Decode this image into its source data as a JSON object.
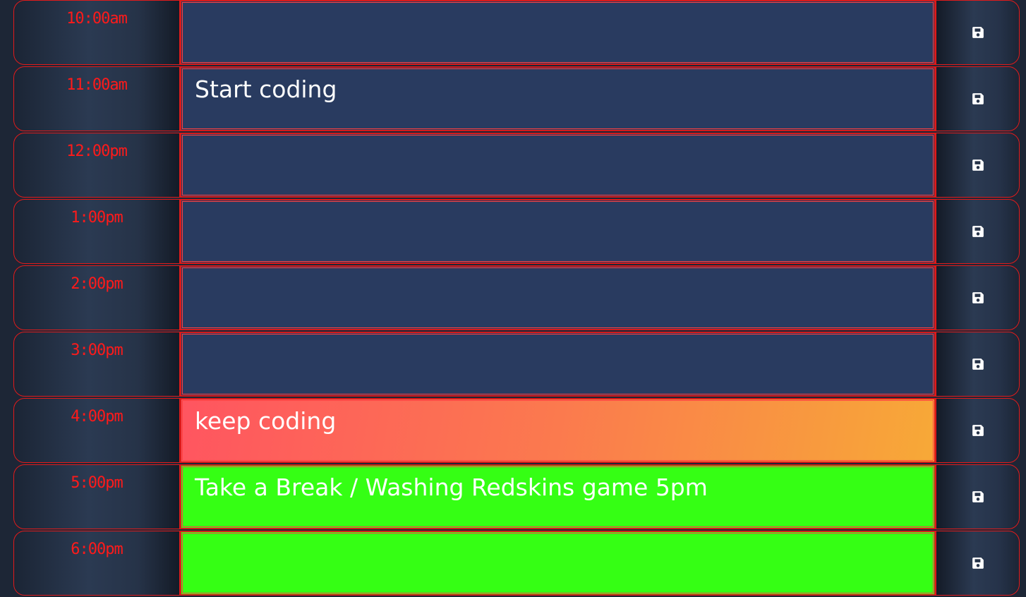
{
  "colors": {
    "past": "#293b60",
    "present_start": "#ff5560",
    "present_end": "#f7a937",
    "future": "#35ff14",
    "hour_text": "#ff1a1a",
    "border": "#e11b1b"
  },
  "rows": [
    {
      "hour": "10:00am",
      "text": "",
      "state": "past",
      "save_icon": "floppy-disk-icon"
    },
    {
      "hour": "11:00am",
      "text": "Start coding",
      "state": "past",
      "save_icon": "floppy-disk-icon"
    },
    {
      "hour": "12:00pm",
      "text": "",
      "state": "past",
      "save_icon": "floppy-disk-icon"
    },
    {
      "hour": "1:00pm",
      "text": "",
      "state": "past",
      "save_icon": "floppy-disk-icon"
    },
    {
      "hour": "2:00pm",
      "text": "",
      "state": "past",
      "save_icon": "floppy-disk-icon"
    },
    {
      "hour": "3:00pm",
      "text": "",
      "state": "past",
      "save_icon": "floppy-disk-icon"
    },
    {
      "hour": "4:00pm",
      "text": "keep coding",
      "state": "present",
      "save_icon": "floppy-disk-icon"
    },
    {
      "hour": "5:00pm",
      "text": "Take a Break / Washing Redskins game 5pm",
      "state": "future",
      "save_icon": "floppy-disk-icon"
    },
    {
      "hour": "6:00pm",
      "text": "",
      "state": "future",
      "save_icon": "floppy-disk-icon"
    }
  ]
}
